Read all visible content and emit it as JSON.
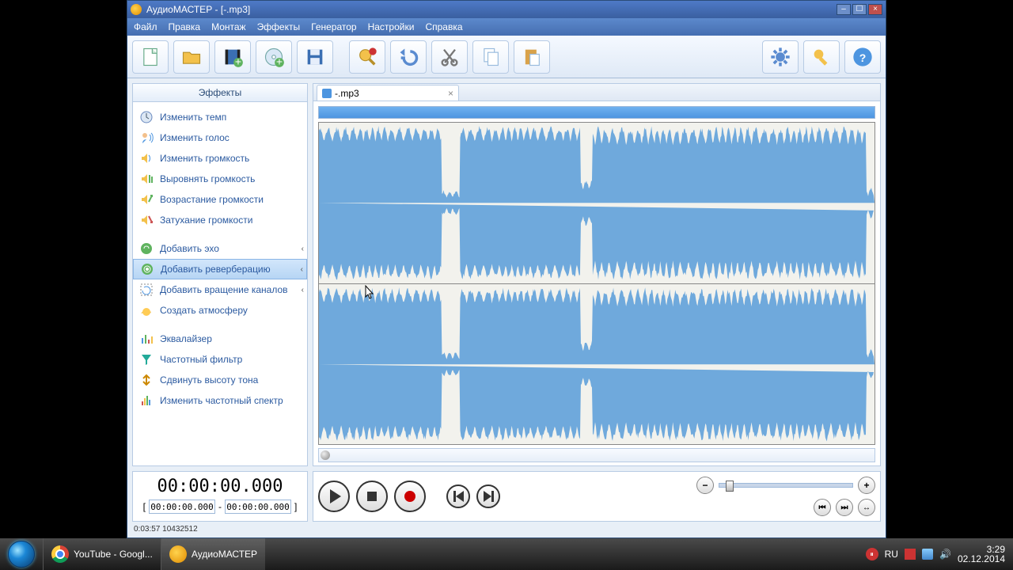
{
  "window": {
    "title": "АудиоМАСТЕР - [-.mp3]"
  },
  "menu": {
    "items": [
      "Файл",
      "Правка",
      "Монтаж",
      "Эффекты",
      "Генератор",
      "Настройки",
      "Справка"
    ]
  },
  "sidebar": {
    "title": "Эффекты",
    "g1": [
      {
        "label": "Изменить темп",
        "icon": "clock"
      },
      {
        "label": "Изменить голос",
        "icon": "voice"
      },
      {
        "label": "Изменить громкость",
        "icon": "vol"
      },
      {
        "label": "Выровнять громкость",
        "icon": "vol-eq"
      },
      {
        "label": "Возрастание громкости",
        "icon": "vol-up"
      },
      {
        "label": "Затухание громкости",
        "icon": "vol-dn"
      }
    ],
    "g2": [
      {
        "label": "Добавить эхо",
        "arrow": true,
        "icon": "echo"
      },
      {
        "label": "Добавить реверберацию",
        "arrow": true,
        "icon": "reverb",
        "selected": true
      },
      {
        "label": "Добавить вращение каналов",
        "arrow": true,
        "icon": "rotate"
      },
      {
        "label": "Создать атмосферу",
        "icon": "atmos"
      }
    ],
    "g3": [
      {
        "label": "Эквалайзер",
        "icon": "eq"
      },
      {
        "label": "Частотный фильтр",
        "icon": "filter"
      },
      {
        "label": "Сдвинуть высоту тона",
        "icon": "pitch"
      },
      {
        "label": "Изменить частотный спектр",
        "icon": "spectrum"
      }
    ]
  },
  "tab": {
    "label": "-.mp3"
  },
  "time": {
    "big": "00:00:00.000",
    "selStart": "00:00:00.000",
    "selEnd": "00:00:00.000"
  },
  "status": "0:03:57 10432512",
  "taskbar": {
    "items": [
      {
        "label": "YouTube - Googl...",
        "icon": "chrome"
      },
      {
        "label": "АудиоМАСТЕР",
        "icon": "app",
        "active": true
      }
    ],
    "clock": {
      "time": "3:29",
      "date": "02.12.2014"
    }
  }
}
